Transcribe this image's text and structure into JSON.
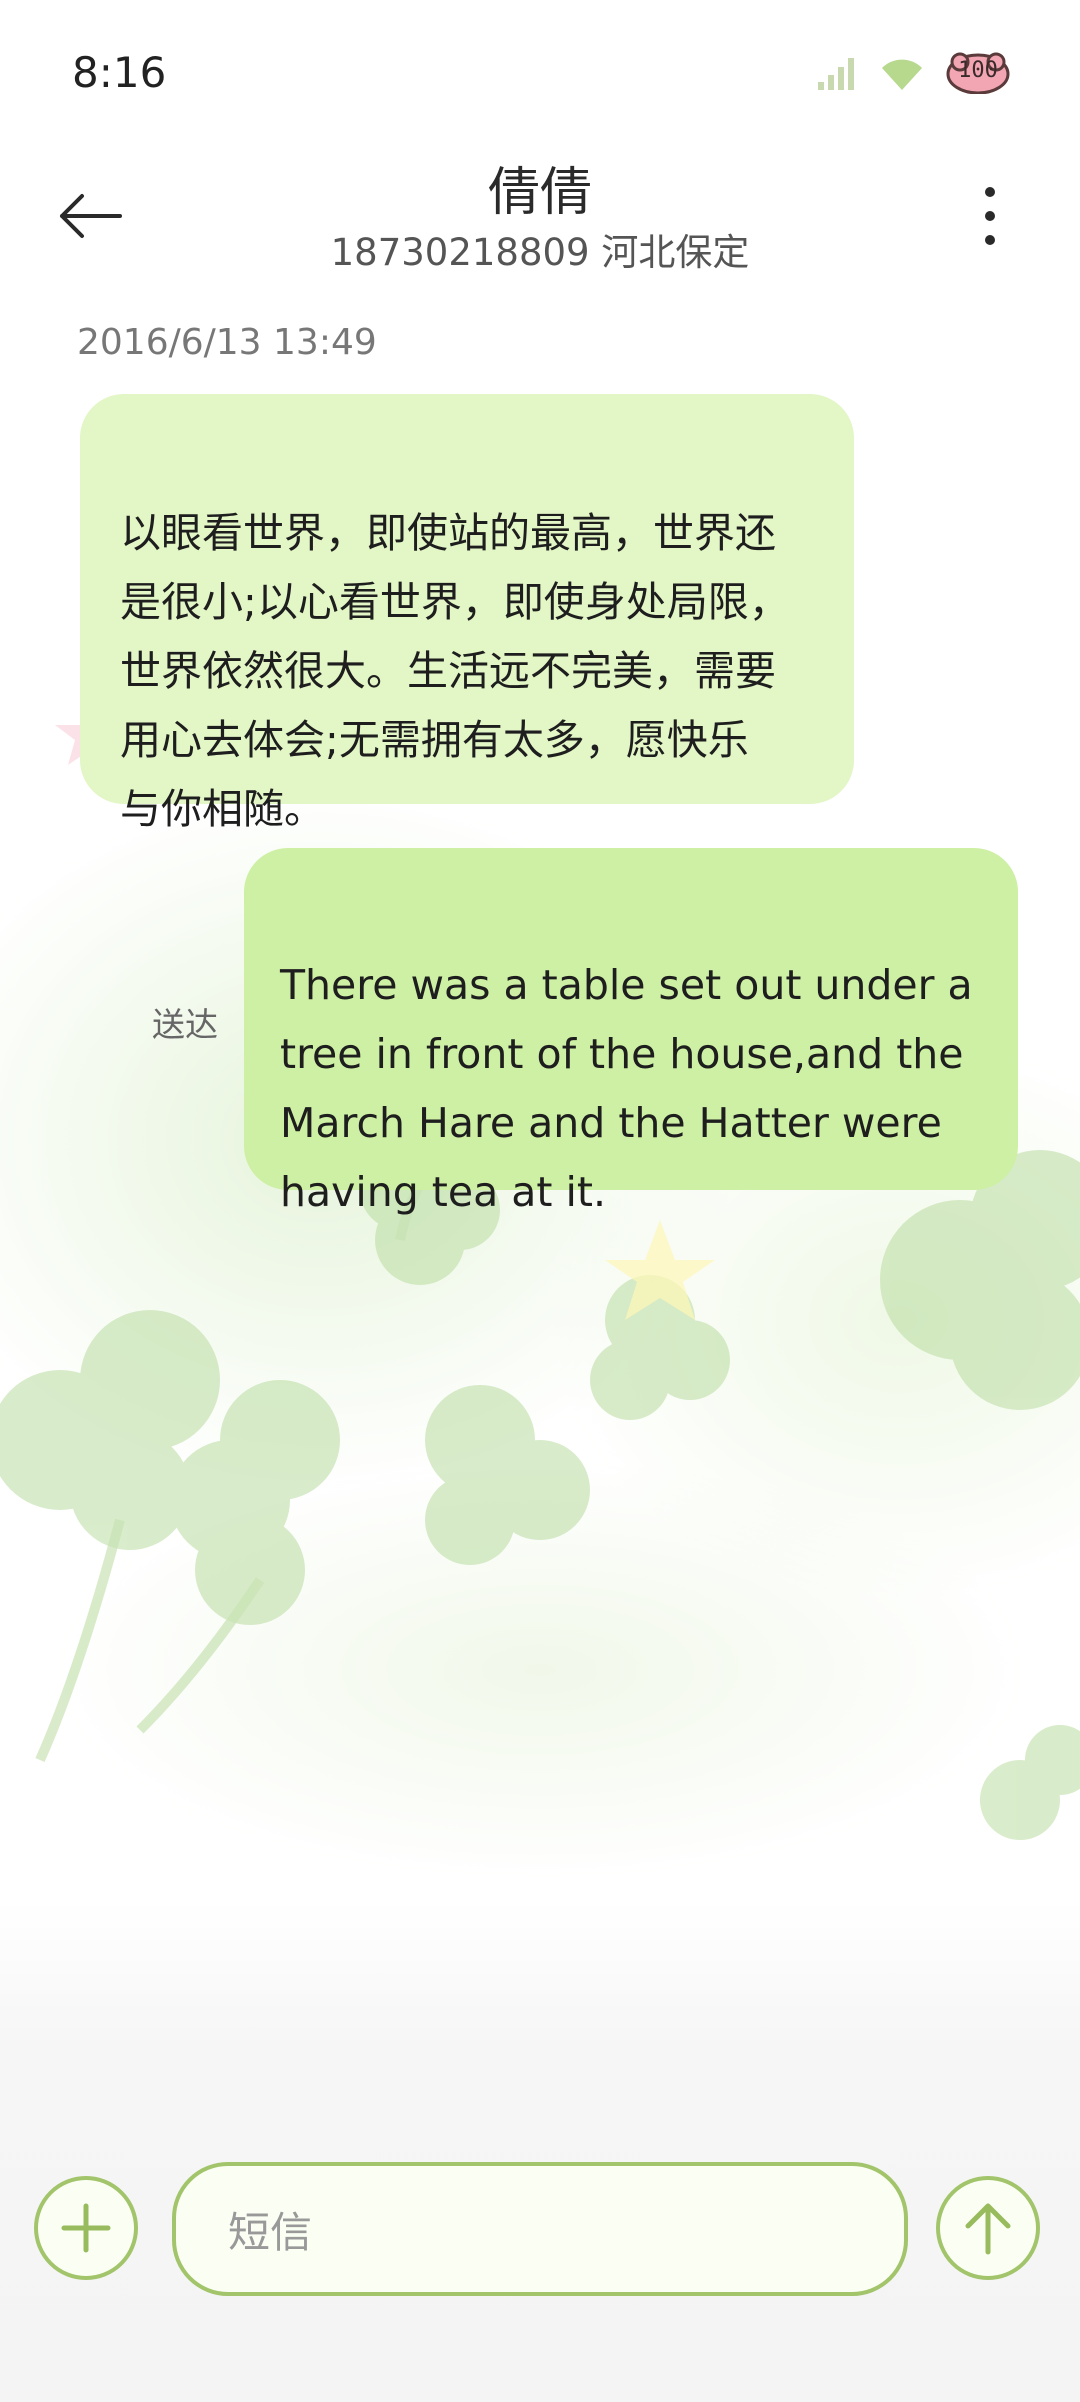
{
  "status_bar": {
    "time": "8:16",
    "battery_level": "100",
    "icons": [
      "signal-icon",
      "wifi-icon",
      "battery-icon"
    ]
  },
  "header": {
    "contact_name": "倩倩",
    "contact_detail": "18730218809 河北保定",
    "back_icon": "back-arrow-icon",
    "more_icon": "more-vertical-icon"
  },
  "conversation": {
    "timestamp": "2016/6/13 13:49",
    "messages": [
      {
        "direction": "incoming",
        "text": "以眼看世界，即使站的最高，世界还\n是很小;以心看世界，即使身处局限，\n世界依然很大。生活远不完美，需要\n用心去体会;无需拥有太多，愿快乐\n与你相随。"
      },
      {
        "direction": "outgoing",
        "text": "There was a table set out under a\ntree in front of the house,and the\nMarch Hare and the Hatter were\nhaving tea at it.",
        "status": "送达"
      }
    ]
  },
  "composer": {
    "placeholder": "短信",
    "add_icon": "plus-icon",
    "send_icon": "send-arrow-icon"
  },
  "colors": {
    "incoming_bubble": "#e2f6c6",
    "outgoing_bubble": "#cdf0a4",
    "accent": "#a2c46a"
  }
}
